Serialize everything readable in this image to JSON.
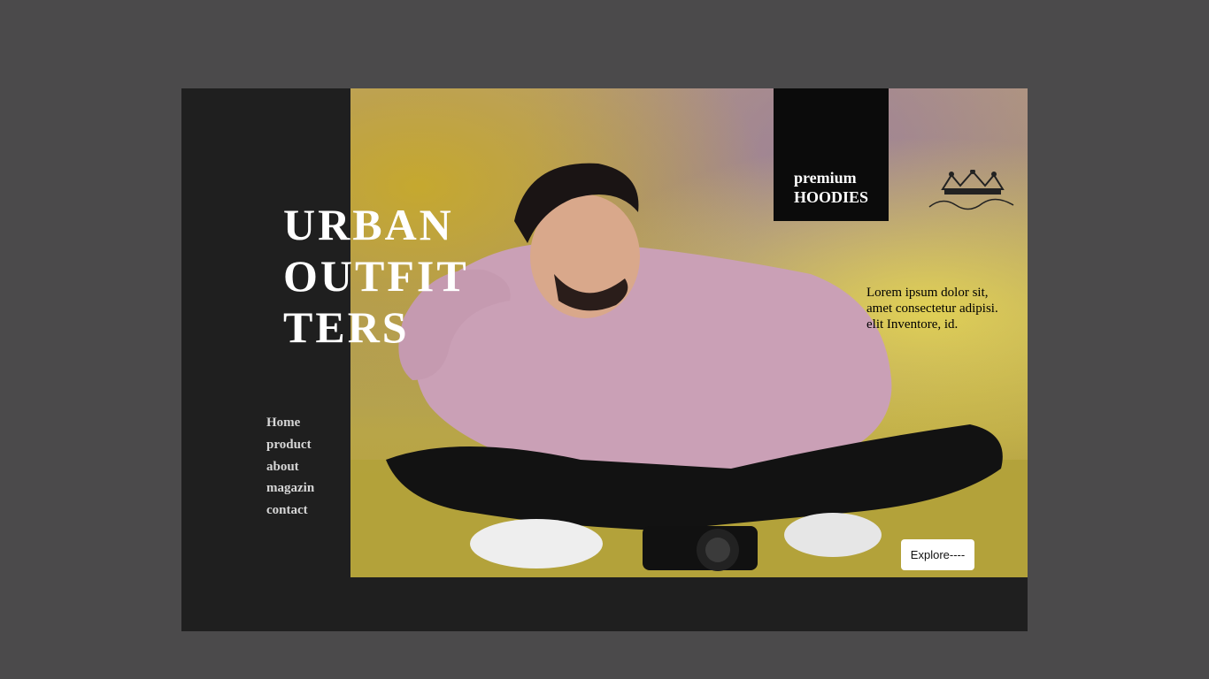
{
  "brand": {
    "title_lines": [
      "URBAN",
      "OUTFIT",
      "TERS"
    ]
  },
  "nav": {
    "items": [
      "Home",
      "product",
      "about",
      "magazin",
      "contact"
    ]
  },
  "badge": {
    "line1": "premium",
    "line2": "HOODIES"
  },
  "blurb": {
    "text": "Lorem ipsum dolor sit, amet consectetur adipisi. elit Inventore, id."
  },
  "cta": {
    "label": "Explore----"
  },
  "logo": {
    "icon": "crown-signature-icon",
    "signature": "Atul Patel"
  },
  "colors": {
    "page_bg": "#4b4a4b",
    "card_bg": "#1f1f1f",
    "badge_bg": "#0b0b0b",
    "title": "#ffffff",
    "nav": "#d6d6d6"
  }
}
